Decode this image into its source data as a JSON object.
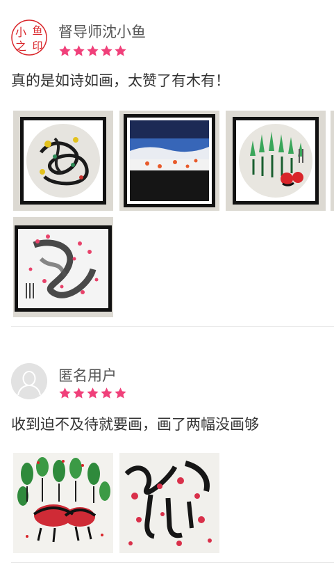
{
  "reviews": [
    {
      "username": "督导师沈小鱼",
      "avatar_text": "小鱼之印",
      "rating": 5,
      "comment": "真的是如诗如画，太赞了有木有！",
      "photos": [
        "framed-painting-round-black-scribble",
        "framed-painting-blue-landscape",
        "framed-painting-round-green-trees",
        "framed-painting-pink-black-blossom"
      ]
    },
    {
      "username": "匿名用户",
      "avatar_text": "",
      "rating": 5,
      "comment": "收到迫不及待就要画，画了两幅没画够",
      "photos": [
        "painting-green-trees-red-shapes",
        "painting-black-ink-red-dots"
      ]
    }
  ],
  "colors": {
    "star": "#f0407a",
    "seal_red": "#d9252a",
    "divider": "#e8e8e8"
  },
  "icons": {
    "star": "star-icon",
    "anon_avatar": "user-silhouette-icon"
  }
}
